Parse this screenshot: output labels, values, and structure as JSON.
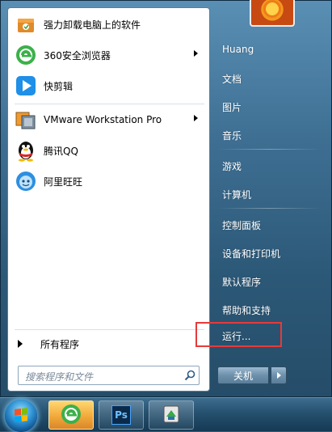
{
  "start_menu": {
    "pinned": [
      {
        "label": "强力卸载电脑上的软件",
        "icon": "uninstall-box-icon",
        "has_submenu": false
      },
      {
        "label": "360安全浏览器",
        "icon": "360-browser-icon",
        "has_submenu": true
      },
      {
        "label": "快剪辑",
        "icon": "video-edit-play-icon",
        "has_submenu": false
      }
    ],
    "recent": [
      {
        "label": "VMware Workstation Pro",
        "icon": "vmware-icon",
        "has_submenu": true
      },
      {
        "label": "腾讯QQ",
        "icon": "qq-penguin-icon",
        "has_submenu": false
      },
      {
        "label": "阿里旺旺",
        "icon": "aliwangwang-icon",
        "has_submenu": false
      }
    ],
    "all_programs": "所有程序",
    "search_placeholder": "搜索程序和文件",
    "right_links": [
      {
        "label": "Huang"
      },
      {
        "label": "文档"
      },
      {
        "label": "图片"
      },
      {
        "label": "音乐"
      },
      {
        "label": "游戏"
      },
      {
        "label": "计算机"
      },
      {
        "label": "控制面板"
      },
      {
        "label": "设备和打印机"
      },
      {
        "label": "默认程序"
      },
      {
        "label": "帮助和支持"
      },
      {
        "label": "运行..."
      }
    ],
    "shutdown_label": "关机",
    "highlight_color": "#e53b3b"
  },
  "taskbar": {
    "items": [
      {
        "name": "start-orb",
        "icon": "windows-logo-icon"
      },
      {
        "name": "360-browser",
        "icon": "360-browser-icon",
        "active": true
      },
      {
        "name": "photoshop",
        "icon": "photoshop-icon",
        "text": "Ps"
      },
      {
        "name": "file-tool",
        "icon": "file-tool-icon"
      }
    ]
  }
}
